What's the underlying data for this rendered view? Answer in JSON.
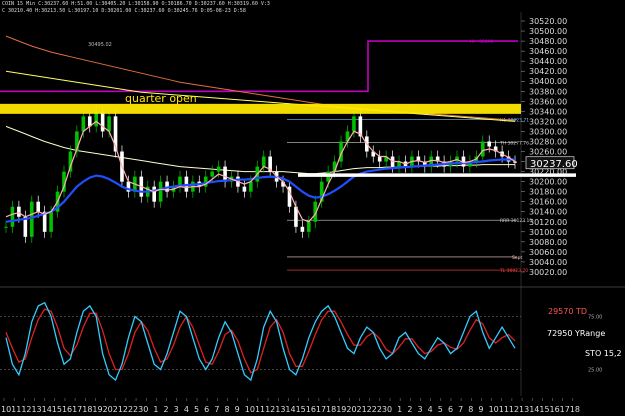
{
  "header": {
    "line1": "COIN 15 Min C:30237.60 H:51.00 L:30405.20 L:30158.90 O:30186.70 D:30237.60 H:30319.60 V:3",
    "line2": "C 30210.40 H:30213.50 L:30197.10 D:30201.00 C:30237.60 O:30245.76 D:05-08-23 D:58"
  },
  "chart_data": {
    "type": "line",
    "price_panel": {
      "ylim": [
        30000,
        30530
      ],
      "y_ticks": [
        30020,
        30040,
        30060,
        30080,
        30100,
        30120,
        30140,
        30160,
        30180,
        30200,
        30220,
        30240,
        30260,
        30280,
        30300,
        30320,
        30340,
        30360,
        30380,
        30400,
        30420,
        30440,
        30460,
        30480,
        30500,
        30520
      ],
      "y_tick_labels": [
        "30020.00",
        "30040.00",
        "30060.00",
        "30080.00",
        "30100.00",
        "30120.00",
        "30140.00",
        "30160.00",
        "30180.00",
        "30200.00",
        "30220.00",
        "30240.00",
        "30260.00",
        "30280.00",
        "30300.00",
        "30320.00",
        "30340.00",
        "30360.00",
        "30380.00",
        "30400.00",
        "30420.00",
        "30440.00",
        "30460.00",
        "30480.00",
        "30500.00",
        "30520.00"
      ],
      "last_price_label": "30237.60",
      "closes": [
        30110,
        30150,
        30130,
        30090,
        30160,
        30140,
        30100,
        30140,
        30180,
        30220,
        30260,
        30300,
        30330,
        30310,
        30340,
        30300,
        30330,
        30260,
        30200,
        30180,
        30210,
        30170,
        30190,
        30160,
        30200,
        30180,
        30190,
        30210,
        30180,
        30200,
        30190,
        30210,
        30220,
        30230,
        30200,
        30210,
        30190,
        30180,
        30200,
        30230,
        30250,
        30220,
        30200,
        30190,
        30150,
        30110,
        30100,
        30120,
        30160,
        30200,
        30220,
        30240,
        30280,
        30300,
        30330,
        30290,
        30260,
        30250,
        30240,
        30250,
        30230,
        30240,
        30230,
        30250,
        30240,
        30230,
        30250,
        30240,
        30230,
        30240,
        30250,
        30230,
        30240,
        30250,
        30280,
        30270,
        30260,
        30250,
        30240,
        30237.6
      ],
      "fast_ma": [
        30130,
        30135,
        30138,
        30130,
        30135,
        30140,
        30135,
        30140,
        30160,
        30190,
        30230,
        30265,
        30300,
        30310,
        30320,
        30310,
        30300,
        30270,
        30230,
        30200,
        30195,
        30190,
        30185,
        30180,
        30185,
        30183,
        30185,
        30190,
        30188,
        30190,
        30190,
        30195,
        30205,
        30215,
        30210,
        30205,
        30200,
        30195,
        30200,
        30215,
        30230,
        30225,
        30210,
        30200,
        30180,
        30150,
        30125,
        30120,
        30135,
        30165,
        30195,
        30220,
        30255,
        30280,
        30300,
        30295,
        30275,
        30260,
        30250,
        30250,
        30240,
        30240,
        30235,
        30240,
        30242,
        30238,
        30242,
        30242,
        30238,
        30240,
        30244,
        30238,
        30240,
        30245,
        30262,
        30265,
        30262,
        30255,
        30248,
        30240
      ],
      "blue_ma": [
        30120,
        30122,
        30124,
        30126,
        30128,
        30132,
        30136,
        30140,
        30148,
        30160,
        30175,
        30190,
        30200,
        30208,
        30212,
        30210,
        30205,
        30198,
        30190,
        30185,
        30182,
        30180,
        30180,
        30182,
        30185,
        30188,
        30190,
        30192,
        30193,
        30194,
        30195,
        30197,
        30199,
        30201,
        30202,
        30203,
        30204,
        30204,
        30205,
        30207,
        30209,
        30210,
        30209,
        30206,
        30200,
        30190,
        30180,
        30172,
        30168,
        30170,
        30175,
        30182,
        30190,
        30200,
        30210,
        30216,
        30220,
        30222,
        30224,
        30226,
        30227,
        30228,
        30229,
        30230,
        30231,
        30232,
        30233,
        30234,
        30235,
        30236,
        30237,
        30237,
        30238,
        30239,
        30240,
        30242,
        30243,
        30244,
        30244,
        30244
      ],
      "white_ma": [
        30310,
        30305,
        30300,
        30295,
        30290,
        30285,
        30280,
        30276,
        30272,
        30268,
        30265,
        30262,
        30260,
        30258,
        30256,
        30254,
        30252,
        30250,
        30248,
        30246,
        30244,
        30242,
        30240,
        30238,
        30236,
        30234,
        30232,
        30230,
        30229,
        30228,
        30227,
        30226,
        30225,
        30224,
        30223,
        30222,
        30221,
        30220,
        30220,
        30220,
        30220,
        30220,
        30220,
        30220,
        30219,
        30218,
        30217,
        30216,
        30216,
        30217,
        30218,
        30220,
        30222,
        30224,
        30226,
        30227,
        30228,
        30228,
        30228,
        30229,
        30229,
        30229,
        30230,
        30230,
        30230,
        30231,
        30231,
        30231,
        30232,
        30232,
        30232,
        30233,
        30233,
        30233,
        30234,
        30234,
        30234,
        30234,
        30234,
        30234
      ],
      "orange_ma": [
        30490,
        30485,
        30480,
        30475,
        30470,
        30466,
        30462,
        30458,
        30455,
        30452,
        30449,
        30446,
        30443,
        30440,
        30437,
        30434,
        30431,
        30428,
        30425,
        30422,
        30419,
        30416,
        30413,
        30410,
        30407,
        30404,
        30401,
        30398,
        30396,
        30394,
        30392,
        30390,
        30388,
        30386,
        30384,
        30382,
        30380,
        30378,
        30376,
        30374,
        30372,
        30370,
        30368,
        30366,
        30364,
        30362,
        30360,
        30358,
        30356,
        30354,
        30352,
        30350,
        30349,
        30348,
        30347,
        30346,
        30345,
        30344,
        30343,
        30342,
        30341,
        30340,
        30339,
        30338,
        30337,
        30336,
        30335,
        30334,
        30333,
        30332,
        30331,
        30330,
        30329,
        30328,
        30327,
        30326,
        30325,
        30324,
        30323,
        30322
      ],
      "yellow_ma": [
        30420,
        30418,
        30416,
        30414,
        30412,
        30410,
        30408,
        30406,
        30404,
        30402,
        30400,
        30398,
        30396,
        30394,
        30392,
        30390,
        30388,
        30386,
        30384,
        30382,
        30380,
        30378,
        30377,
        30376,
        30375,
        30374,
        30373,
        30372,
        30371,
        30370,
        30369,
        30368,
        30367,
        30366,
        30365,
        30364,
        30363,
        30362,
        30361,
        30360,
        30359,
        30358,
        30357,
        30356,
        30355,
        30354,
        30353,
        30352,
        30351,
        30350,
        30349,
        30348,
        30347,
        30346,
        30345,
        30344,
        30343,
        30342,
        30341,
        30340,
        30339,
        30338,
        30337,
        30336,
        30335,
        30334,
        30333,
        30332,
        30331,
        30330,
        30329,
        30328,
        30327,
        30326,
        30325,
        30324,
        30323,
        30322,
        30321,
        30320
      ],
      "quarter_open": {
        "label": "quarter open",
        "price": 30345,
        "color": "#ffe800"
      },
      "support_line": {
        "price": 30213,
        "color": "#ffffff"
      },
      "magenta_level": {
        "label": "Hi - 30490",
        "price": 30480,
        "color": "#c000c0"
      },
      "levels": [
        {
          "label": "H1 30323.71",
          "price": 30323.71,
          "color": "#7fbfff"
        },
        {
          "label": "TH 30277.76",
          "price": 30277.76,
          "color": "#cfcfcf"
        },
        {
          "label": "RRR 30123.10",
          "price": 30123.1,
          "color": "#cfcfcf"
        },
        {
          "label": "Sept",
          "price": 30050,
          "color": "#ffcccc"
        },
        {
          "label": "TL 30023.70",
          "price": 30023.7,
          "color": "#ff4040"
        }
      ],
      "left_price_tag": "30495.02",
      "colors": {
        "bull": "#00c000",
        "bear": "#ffffff",
        "fast_ma": "#ffb0b0",
        "blue_ma": "#1f4fff",
        "white_ma": "#ffffcc",
        "orange_ma": "#e07040",
        "yellow_ma": "#ffff66"
      }
    },
    "oscillator_panel": {
      "ylim": [
        0,
        100
      ],
      "ref_lines": [
        75,
        25
      ],
      "ref_labels": [
        "75.00",
        "25.00"
      ],
      "text_labels": [
        "29570 TD",
        "72950 YRange",
        "STO 15,2"
      ],
      "stoch_k": [
        55,
        30,
        20,
        40,
        70,
        85,
        88,
        75,
        50,
        30,
        35,
        60,
        80,
        85,
        75,
        40,
        20,
        15,
        30,
        55,
        75,
        70,
        50,
        30,
        25,
        40,
        60,
        80,
        75,
        55,
        35,
        25,
        35,
        55,
        70,
        60,
        40,
        20,
        15,
        35,
        65,
        80,
        70,
        45,
        25,
        20,
        35,
        55,
        70,
        80,
        85,
        75,
        60,
        45,
        40,
        55,
        65,
        60,
        45,
        35,
        40,
        55,
        60,
        50,
        40,
        35,
        45,
        55,
        50,
        40,
        45,
        60,
        75,
        80,
        60,
        45,
        55,
        65,
        55,
        45
      ],
      "stoch_d": [
        60,
        45,
        32,
        35,
        55,
        72,
        82,
        80,
        65,
        45,
        38,
        48,
        65,
        78,
        78,
        62,
        40,
        25,
        25,
        40,
        60,
        70,
        62,
        45,
        32,
        35,
        48,
        65,
        75,
        65,
        48,
        32,
        30,
        42,
        58,
        62,
        52,
        35,
        22,
        25,
        45,
        65,
        72,
        60,
        40,
        28,
        28,
        42,
        58,
        72,
        80,
        80,
        70,
        58,
        48,
        48,
        56,
        60,
        54,
        44,
        40,
        46,
        54,
        54,
        46,
        40,
        42,
        48,
        50,
        46,
        44,
        50,
        62,
        72,
        68,
        55,
        50,
        55,
        58,
        52
      ],
      "colors": {
        "k": "#33ccff",
        "d": "#dd2222",
        "ref": "#888888"
      }
    },
    "x_tick_labels": [
      "10",
      "11",
      "12",
      "13",
      "14",
      "15",
      "16",
      "17",
      "18",
      "19",
      "20",
      "21",
      "22",
      "23",
      "0",
      "1",
      "2",
      "3",
      "4",
      "5",
      "6",
      "7",
      "8",
      "9",
      "10",
      "11",
      "12",
      "13",
      "14",
      "15",
      "16",
      "17",
      "18",
      "19",
      "20",
      "21",
      "22",
      "23",
      "0",
      "1",
      "2",
      "3",
      "4",
      "5",
      "6",
      "7",
      "8",
      "9",
      "10",
      "11",
      "12",
      "13",
      "14",
      "15",
      "16",
      "17",
      "18"
    ]
  }
}
